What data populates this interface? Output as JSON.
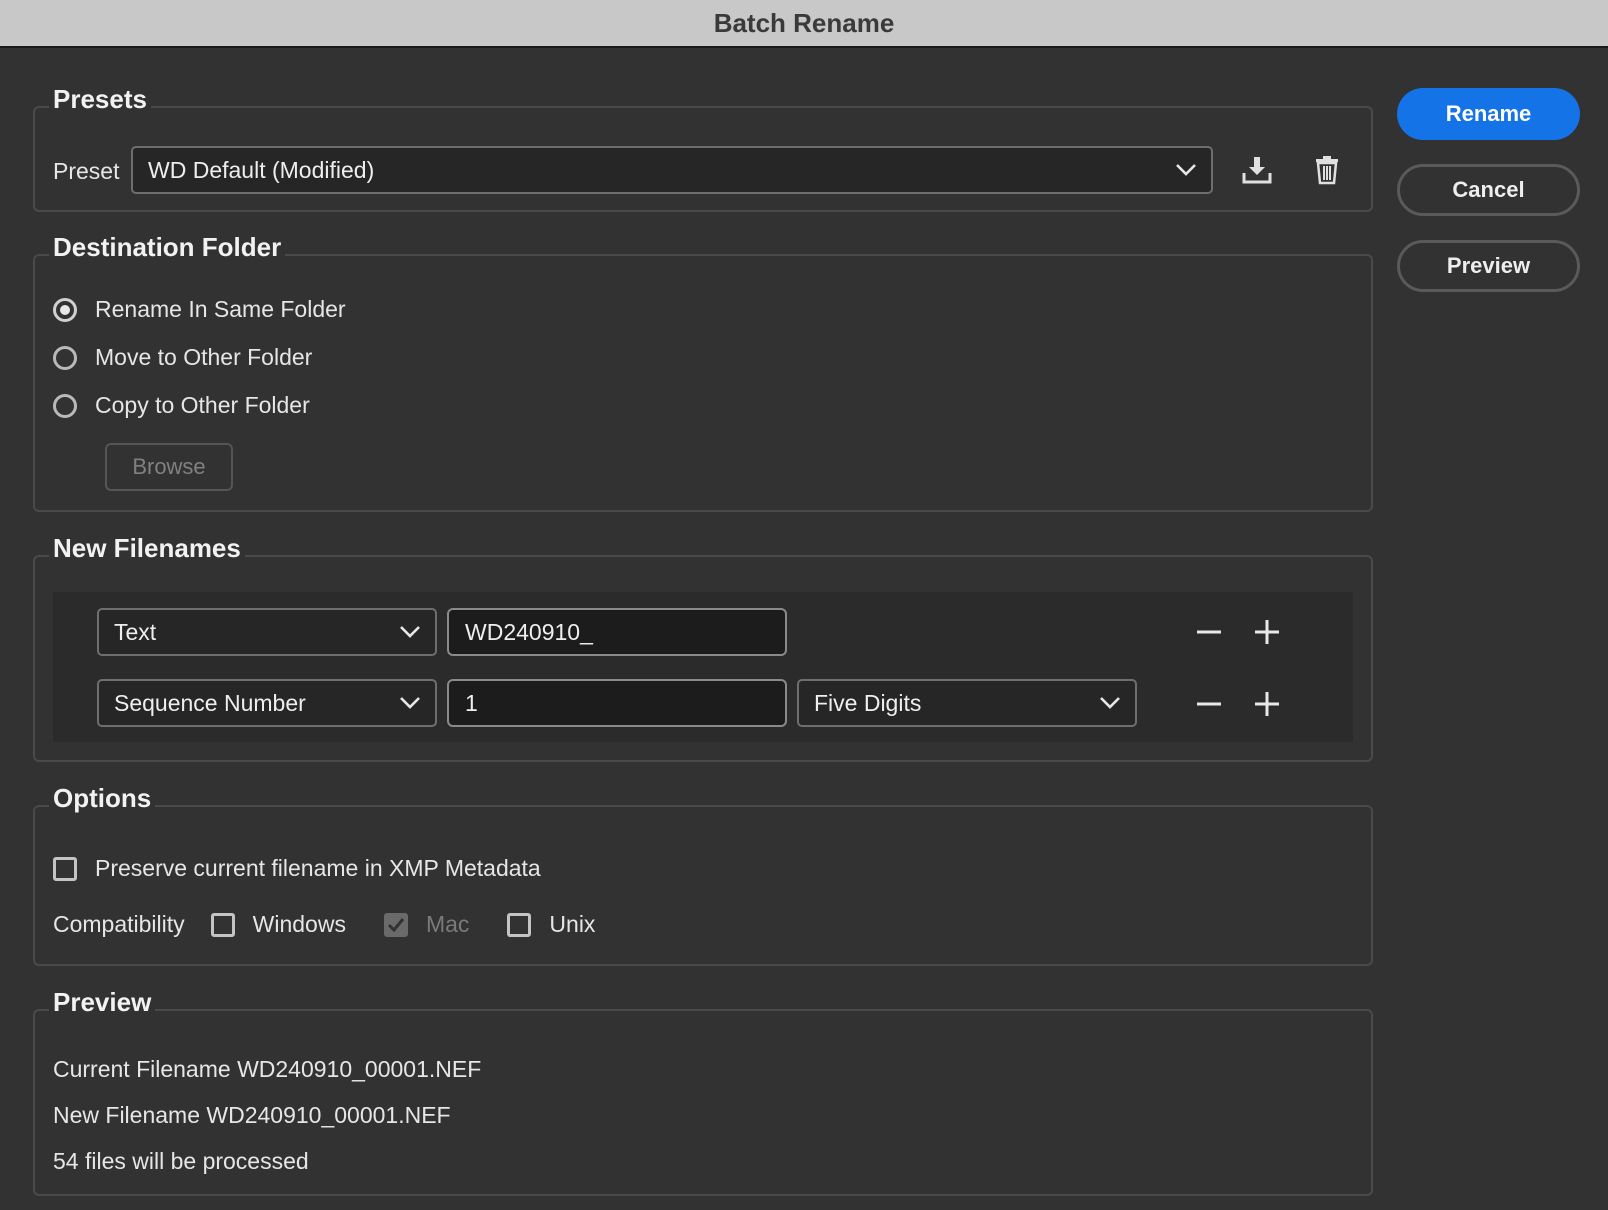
{
  "window": {
    "title": "Batch Rename"
  },
  "actions": {
    "rename": "Rename",
    "cancel": "Cancel",
    "preview": "Preview"
  },
  "presets": {
    "legend": "Presets",
    "preset_label": "Preset",
    "preset_value": "WD Default (Modified)"
  },
  "destination": {
    "legend": "Destination Folder",
    "options": [
      "Rename In Same Folder",
      "Move to Other Folder",
      "Copy to Other Folder"
    ],
    "selected": "Rename In Same Folder",
    "browse": "Browse"
  },
  "new_filenames": {
    "legend": "New Filenames",
    "rows": [
      {
        "type": "Text",
        "value": "WD240910_"
      },
      {
        "type": "Sequence Number",
        "value": "1",
        "format": "Five Digits"
      }
    ]
  },
  "options": {
    "legend": "Options",
    "preserve_label": "Preserve current filename in XMP Metadata",
    "preserve_checked": false,
    "compat_label": "Compatibility",
    "windows": "Windows",
    "mac": "Mac",
    "unix": "Unix"
  },
  "preview": {
    "legend": "Preview",
    "current": "Current Filename WD240910_00001.NEF",
    "new": "New Filename WD240910_00001.NEF",
    "count": "54 files will be processed"
  },
  "colors": {
    "accent": "#1473e6",
    "background": "#323232",
    "titlebar": "#c8c8c8"
  }
}
